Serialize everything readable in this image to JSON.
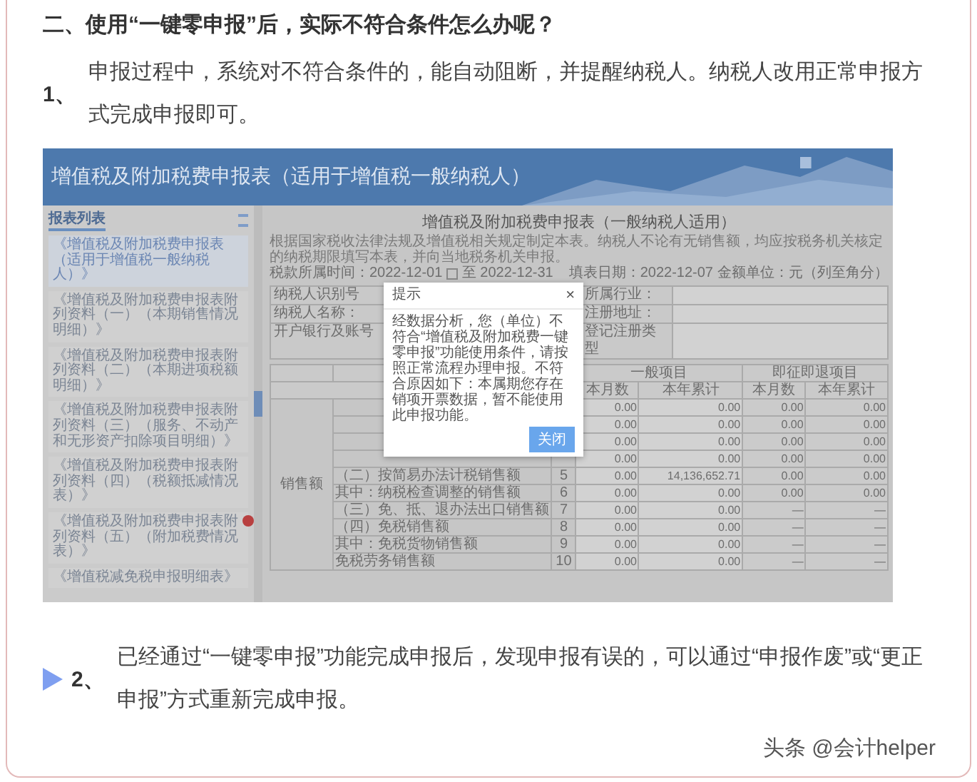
{
  "heading": "二、使用“一键零申报”后，实际不符合条件怎么办呢？",
  "items": [
    {
      "number": "1、",
      "marker": false,
      "text": "申报过程中，系统对不符合条件的，能自动阻断，并提醒纳税人。纳税人改用正常申报方式完成申报即可。"
    },
    {
      "number": "2、",
      "marker": true,
      "text": "已经通过“一键零申报”功能完成申报后，发现申报有误的，可以通过“申报作废”或“更正申报”方式重新完成申报。"
    }
  ],
  "screenshot": {
    "header_title": "增值税及附加税费申报表（适用于增值税一般纳税人）",
    "sidebar": {
      "tab": "报表列表",
      "items": [
        {
          "text": "《增值税及附加税费申报表（适用于增值税一般纳税人）》",
          "selected": true,
          "alert": false
        },
        {
          "text": "《增值税及附加税费申报表附列资料（一）（本期销售情况明细）》",
          "selected": false,
          "alert": false
        },
        {
          "text": "《增值税及附加税费申报表附列资料（二）（本期进项税额明细）》",
          "selected": false,
          "alert": false
        },
        {
          "text": "《增值税及附加税费申报表附列资料（三）（服务、不动产和无形资产扣除项目明细）》",
          "selected": false,
          "alert": false
        },
        {
          "text": "《增值税及附加税费申报表附列资料（四）（税额抵减情况表）》",
          "selected": false,
          "alert": false
        },
        {
          "text": "《增值税及附加税费申报表附列资料（五）（附加税费情况表）》",
          "selected": false,
          "alert": true
        },
        {
          "text": "《增值税减免税申报明细表》",
          "selected": false,
          "alert": false
        }
      ]
    },
    "form": {
      "title": "增值税及附加税费申报表（一般纳税人适用）",
      "note": "根据国家税收法律法规及增值税相关规定制定本表。纳税人不论有无销售额，均应按税务机关核定的纳税期限填写本表，并向当地税务机关申报。",
      "period_from": "税款所属时间：2022-12-01",
      "period_to": "至 2022-12-31",
      "fill_date": "填表日期：2022-12-07",
      "unit": "金额单位：元（列至角分）",
      "info": [
        {
          "left": "纳税人识别号",
          "right": "所属行业："
        },
        {
          "left": "纳税人名称：",
          "right": "注册地址："
        },
        {
          "left": "开户银行及账号",
          "right": "登记注册类型"
        }
      ],
      "table": {
        "group": "销售额",
        "column_groups": [
          "一般项目",
          "即征即退项目"
        ],
        "columns": [
          "本月数",
          "本年累计",
          "本月数",
          "本年累计"
        ],
        "rows": [
          {
            "values": [
              "0.00",
              "0.00",
              "0.00",
              "0.00"
            ]
          },
          {
            "values": [
              "0.00",
              "0.00",
              "0.00",
              "0.00"
            ]
          },
          {
            "values": [
              "0.00",
              "0.00",
              "0.00",
              "0.00"
            ]
          },
          {
            "values": [
              "0.00",
              "0.00",
              "0.00",
              "0.00"
            ]
          },
          {
            "label": "（二）按简易办法计税销售额",
            "no": "5",
            "values": [
              "0.00",
              "14,136,652.71",
              "0.00",
              "0.00"
            ]
          },
          {
            "label": "其中：纳税检查调整的销售额",
            "no": "6",
            "values": [
              "0.00",
              "0.00",
              "0.00",
              "0.00"
            ]
          },
          {
            "label": "（三）免、抵、退办法出口销售额",
            "no": "7",
            "values": [
              "0.00",
              "0.00",
              "—",
              "—"
            ]
          },
          {
            "label": "（四）免税销售额",
            "no": "8",
            "values": [
              "0.00",
              "0.00",
              "—",
              "—"
            ]
          },
          {
            "label": "其中：免税货物销售额",
            "no": "9",
            "values": [
              "0.00",
              "0.00",
              "—",
              "—"
            ]
          },
          {
            "label": "免税劳务销售额",
            "no": "10",
            "values": [
              "0.00",
              "0.00",
              "—",
              "—"
            ]
          }
        ]
      }
    },
    "dialog": {
      "title": "提示",
      "close": "×",
      "message": "经数据分析，您（单位）不符合“增值税及附加税费一键零申报”功能使用条件，请按照正常流程办理申报。不符合原因如下：本属期您存在销项开票数据，暂不能使用此申报功能。",
      "button": "关闭"
    }
  },
  "footer": "头条 @会计helper"
}
